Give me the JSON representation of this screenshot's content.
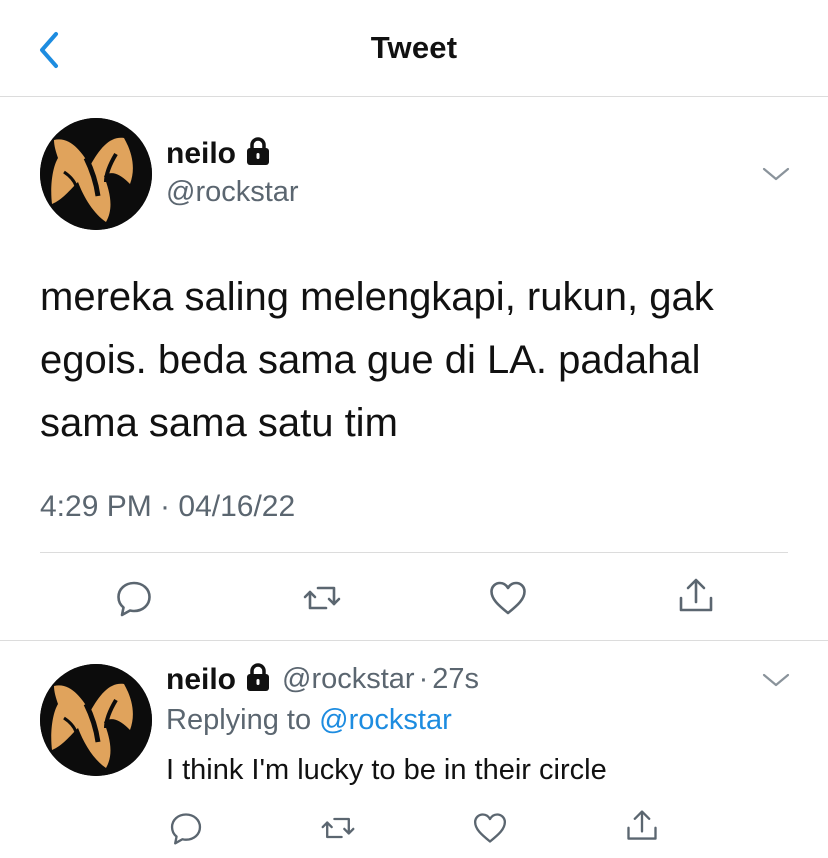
{
  "header": {
    "title": "Tweet",
    "back_icon": "chevron-left-icon",
    "accent": "#1d8ce0"
  },
  "tweet": {
    "name": "neilo",
    "handle": "@rockstar",
    "locked": true,
    "text": "mereka saling melengkapi, rukun, gak egois. beda sama gue di LA. padahal sama sama satu tim",
    "timestamp": "4:29 PM · 04/16/22",
    "actions": [
      "reply-icon",
      "retweet-icon",
      "like-icon",
      "share-icon"
    ]
  },
  "reply": {
    "name": "neilo",
    "handle": "@rockstar",
    "separator": "·",
    "time": "27s",
    "replying_label": "Replying to",
    "replying_to": "@rockstar",
    "text": "I think I'm lucky to be in their circle",
    "actions": [
      "reply-icon",
      "retweet-icon",
      "like-icon",
      "share-icon"
    ]
  },
  "colors": {
    "text": "#111111",
    "secondary": "#5b6670",
    "link": "#1d8ce0",
    "divider": "#dcdcdc"
  }
}
